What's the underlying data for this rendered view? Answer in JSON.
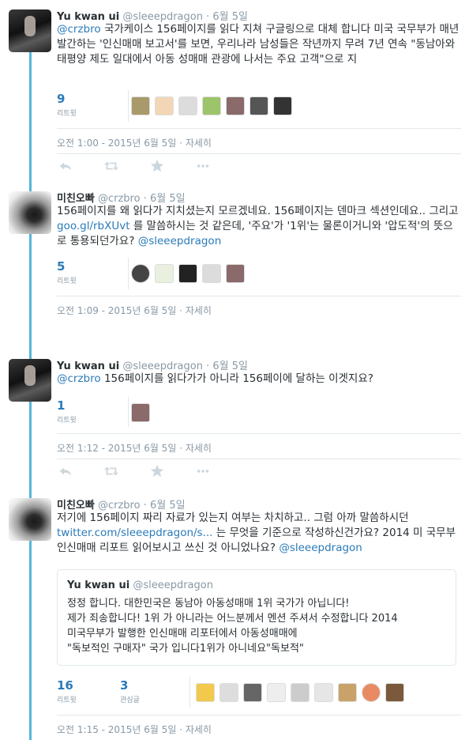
{
  "tweets": [
    {
      "name": "Yu kwan ui",
      "handle": "@sleeepdragon",
      "date": "6월 5일",
      "mention": "@crzbro",
      "text_after_mention": " 국가케이스 156페이지를 읽다 지쳐 구글링으로 대체 합니다 미국 국무부가 매년 발간하는 '인신매매 보고서'를 보면, 우리나라 남성들은 작년까지 무려 7년 연속 \"동남아와 태평양 제도 일대에서 아동 성매매 관광에 나서는 주요 고객\"으로 지",
      "stat_count": "9",
      "stat_label": "리트윗",
      "timestamp": "오전 1:00 - 2015년 6월 5일",
      "details": "· 자세히"
    },
    {
      "name": "미친오빠",
      "handle": "@crzbro",
      "date": "6월 5일",
      "text_part1": "156페이지를 왜 읽다가 지치셨는지 모르겠네요. 156페이지는 덴마크 섹션인데요.. 그리고 ",
      "link": "goo.gl/rbXUvt",
      "text_part2": " 를 말씀하시는 것 같은데, '주요'가 '1위'는 물론이거니와 '압도적'의 뜻으로 통용되던가요? ",
      "mention_end": "@sleeepdragon",
      "stat_count": "5",
      "stat_label": "리트윗",
      "timestamp": "오전 1:09 - 2015년 6월 5일",
      "details": "· 자세히"
    },
    {
      "name": "Yu kwan ui",
      "handle": "@sleeepdragon",
      "date": "6월 5일",
      "mention": "@crzbro",
      "text_after_mention": " 156페이지를 읽다가가 아니라 156페이에 달하는 이겟지요?",
      "stat_count": "1",
      "stat_label": "리트윗",
      "timestamp": "오전 1:12 - 2015년 6월 5일",
      "details": "· 자세히"
    },
    {
      "name": "미친오빠",
      "handle": "@crzbro",
      "date": "6월 5일",
      "text_part1": "저기에 156페이지 짜리 자료가 있는지 여부는 차치하고.. 그럼 아까 말씀하시던 ",
      "link": "twitter.com/sleeepdragon/s...",
      "text_part2": " 는 무엇을 기준으로 작성하신건가요? 2014 미 국무부 인신매매 리포트 읽어보시고 쓰신 것 아니었나요? ",
      "mention_end": "@sleeepdragon",
      "quote": {
        "name": "Yu kwan ui",
        "handle": "@sleeepdragon",
        "line1": "정정 합니다. 대한민국은 동남아 아동성매매 1위 국가가 아닙니다!",
        "line2": "제가 죄송합니다! 1위 가 아니라는 어느분께서 멘션 주셔서 수정합니다 2014",
        "line3": "미국무부가 발행한 인신매매 리포터에서 아동성매매에",
        "line4": "\"독보적인 구매자\" 국가 입니다1위가 아니네요\"독보적\""
      },
      "stat_count": "16",
      "stat_label": "리트윗",
      "stat2_count": "3",
      "stat2_label": "관심글",
      "timestamp": "오전 1:15 - 2015년 6월 5일",
      "details": "· 자세히"
    }
  ],
  "colors": {
    "link": "#2b7bb9",
    "thread_line": "#55b6d9",
    "muted": "#8899a6",
    "action_icon": "#ccd6dd"
  },
  "icons": [
    "reply-icon",
    "retweet-icon",
    "favorite-icon",
    "more-icon"
  ]
}
